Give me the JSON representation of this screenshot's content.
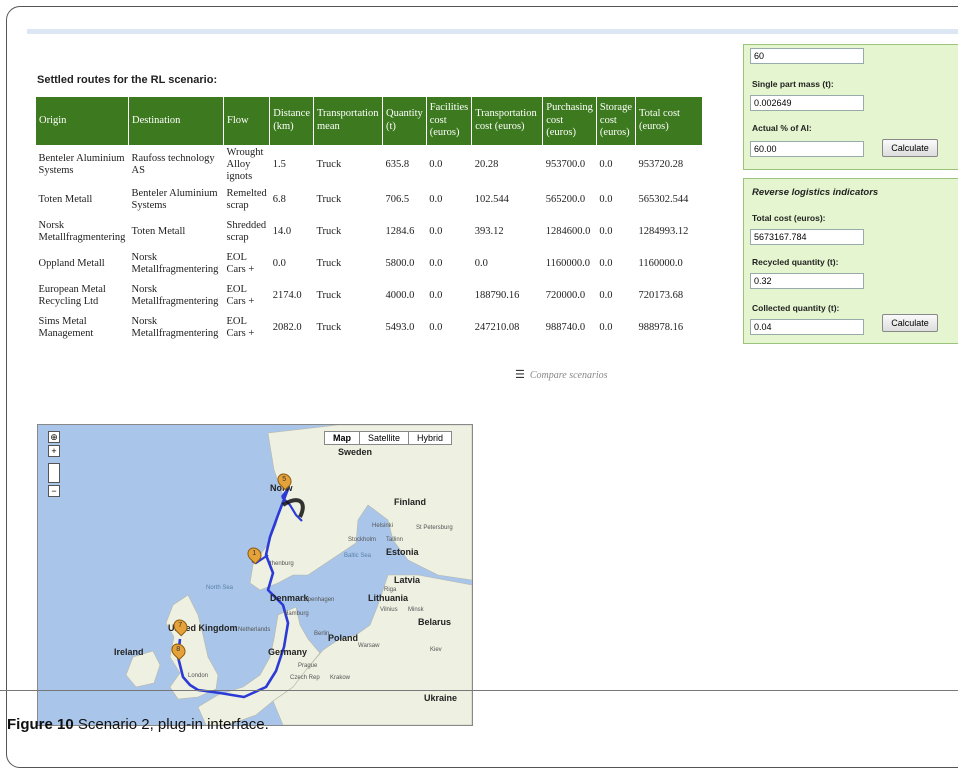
{
  "section_title": "Settled routes for the RL scenario:",
  "table": {
    "headers": [
      "Origin",
      "Destination",
      "Flow",
      "Distance (km)",
      "Transportation mean",
      "Quantity (t)",
      "Facilities cost (euros)",
      "Transportation cost (euros)",
      "Purchasing cost (euros)",
      "Storage cost (euros)",
      "Total cost (euros)"
    ],
    "rows": [
      [
        "Benteler Aluminium Systems",
        "Raufoss technology AS",
        "Wrought Alloy ignots",
        "1.5",
        "Truck",
        "635.8",
        "0.0",
        "20.28",
        "953700.0",
        "0.0",
        "953720.28"
      ],
      [
        "Toten Metall",
        "Benteler Aluminium Systems",
        "Remelted scrap",
        "6.8",
        "Truck",
        "706.5",
        "0.0",
        "102.544",
        "565200.0",
        "0.0",
        "565302.544"
      ],
      [
        "Norsk Metallfragmentering",
        "Toten Metall",
        "Shredded scrap",
        "14.0",
        "Truck",
        "1284.6",
        "0.0",
        "393.12",
        "1284600.0",
        "0.0",
        "1284993.12"
      ],
      [
        "Oppland Metall",
        "Norsk Metallfragmentering",
        "EOL Cars +",
        "0.0",
        "Truck",
        "5800.0",
        "0.0",
        "0.0",
        "1160000.0",
        "0.0",
        "1160000.0"
      ],
      [
        "European Metal Recycling Ltd",
        "Norsk Metallfragmentering",
        "EOL Cars +",
        "2174.0",
        "Truck",
        "4000.0",
        "0.0",
        "188790.16",
        "720000.0",
        "0.0",
        "720173.68"
      ],
      [
        "Sims Metal Management",
        "Norsk Metallfragmentering",
        "EOL Cars +",
        "2082.0",
        "Truck",
        "5493.0",
        "0.0",
        "247210.08",
        "988740.0",
        "0.0",
        "988978.16"
      ]
    ]
  },
  "compare_link": "Compare scenarios",
  "inputs_panel": {
    "top_value": "60",
    "mass_label": "Single part mass (t):",
    "mass_value": "0.002649",
    "al_label": "Actual % of Al:",
    "al_value": "60.00",
    "calc_label": "Calculate"
  },
  "indicators_panel": {
    "title": "Reverse logistics indicators",
    "total_cost_label": "Total cost (euros):",
    "total_cost_value": "5673167.784",
    "recycled_label": "Recycled quantity (t):",
    "recycled_value": "0.32",
    "collected_label": "Collected quantity (t):",
    "collected_value": "0.04",
    "calc_label": "Calculate"
  },
  "map": {
    "tabs": [
      "Map",
      "Satellite",
      "Hybrid"
    ],
    "labels": {
      "sweden": "Sweden",
      "norway": "Norw",
      "finland": "Finland",
      "estonia": "Estonia",
      "latvia": "Latvia",
      "lithuania": "Lithuania",
      "belarus": "Belarus",
      "poland": "Poland",
      "germany": "Germany",
      "denmark": "Denmark",
      "netherlands": "Netherlands",
      "uk": "United Kingdom",
      "ireland": "Ireland",
      "ukraine": "Ukraine",
      "north_sea": "North Sea",
      "baltic_sea": "Baltic Sea",
      "stockholm": "Stockholm",
      "helsinki": "Helsinki",
      "st_petersburg": "St Petersburg",
      "tallinn": "Tallinn",
      "riga": "Riga",
      "copenhagen": "Copenhagen",
      "hamburg": "Hamburg",
      "berlin": "Berlin",
      "vilnius": "Vilnius",
      "minsk": "Minsk",
      "kiev": "Kiev",
      "warsaw": "Warsaw",
      "prague": "Prague",
      "czech_rep": "Czech Rep",
      "krakow": "Krakow",
      "gothenburg": "thenburg",
      "london": "London"
    },
    "pins": [
      "1",
      "5",
      "7",
      "8"
    ]
  },
  "caption": {
    "label": "Figure 10",
    "text": "Scenario 2, plug-in interface."
  }
}
